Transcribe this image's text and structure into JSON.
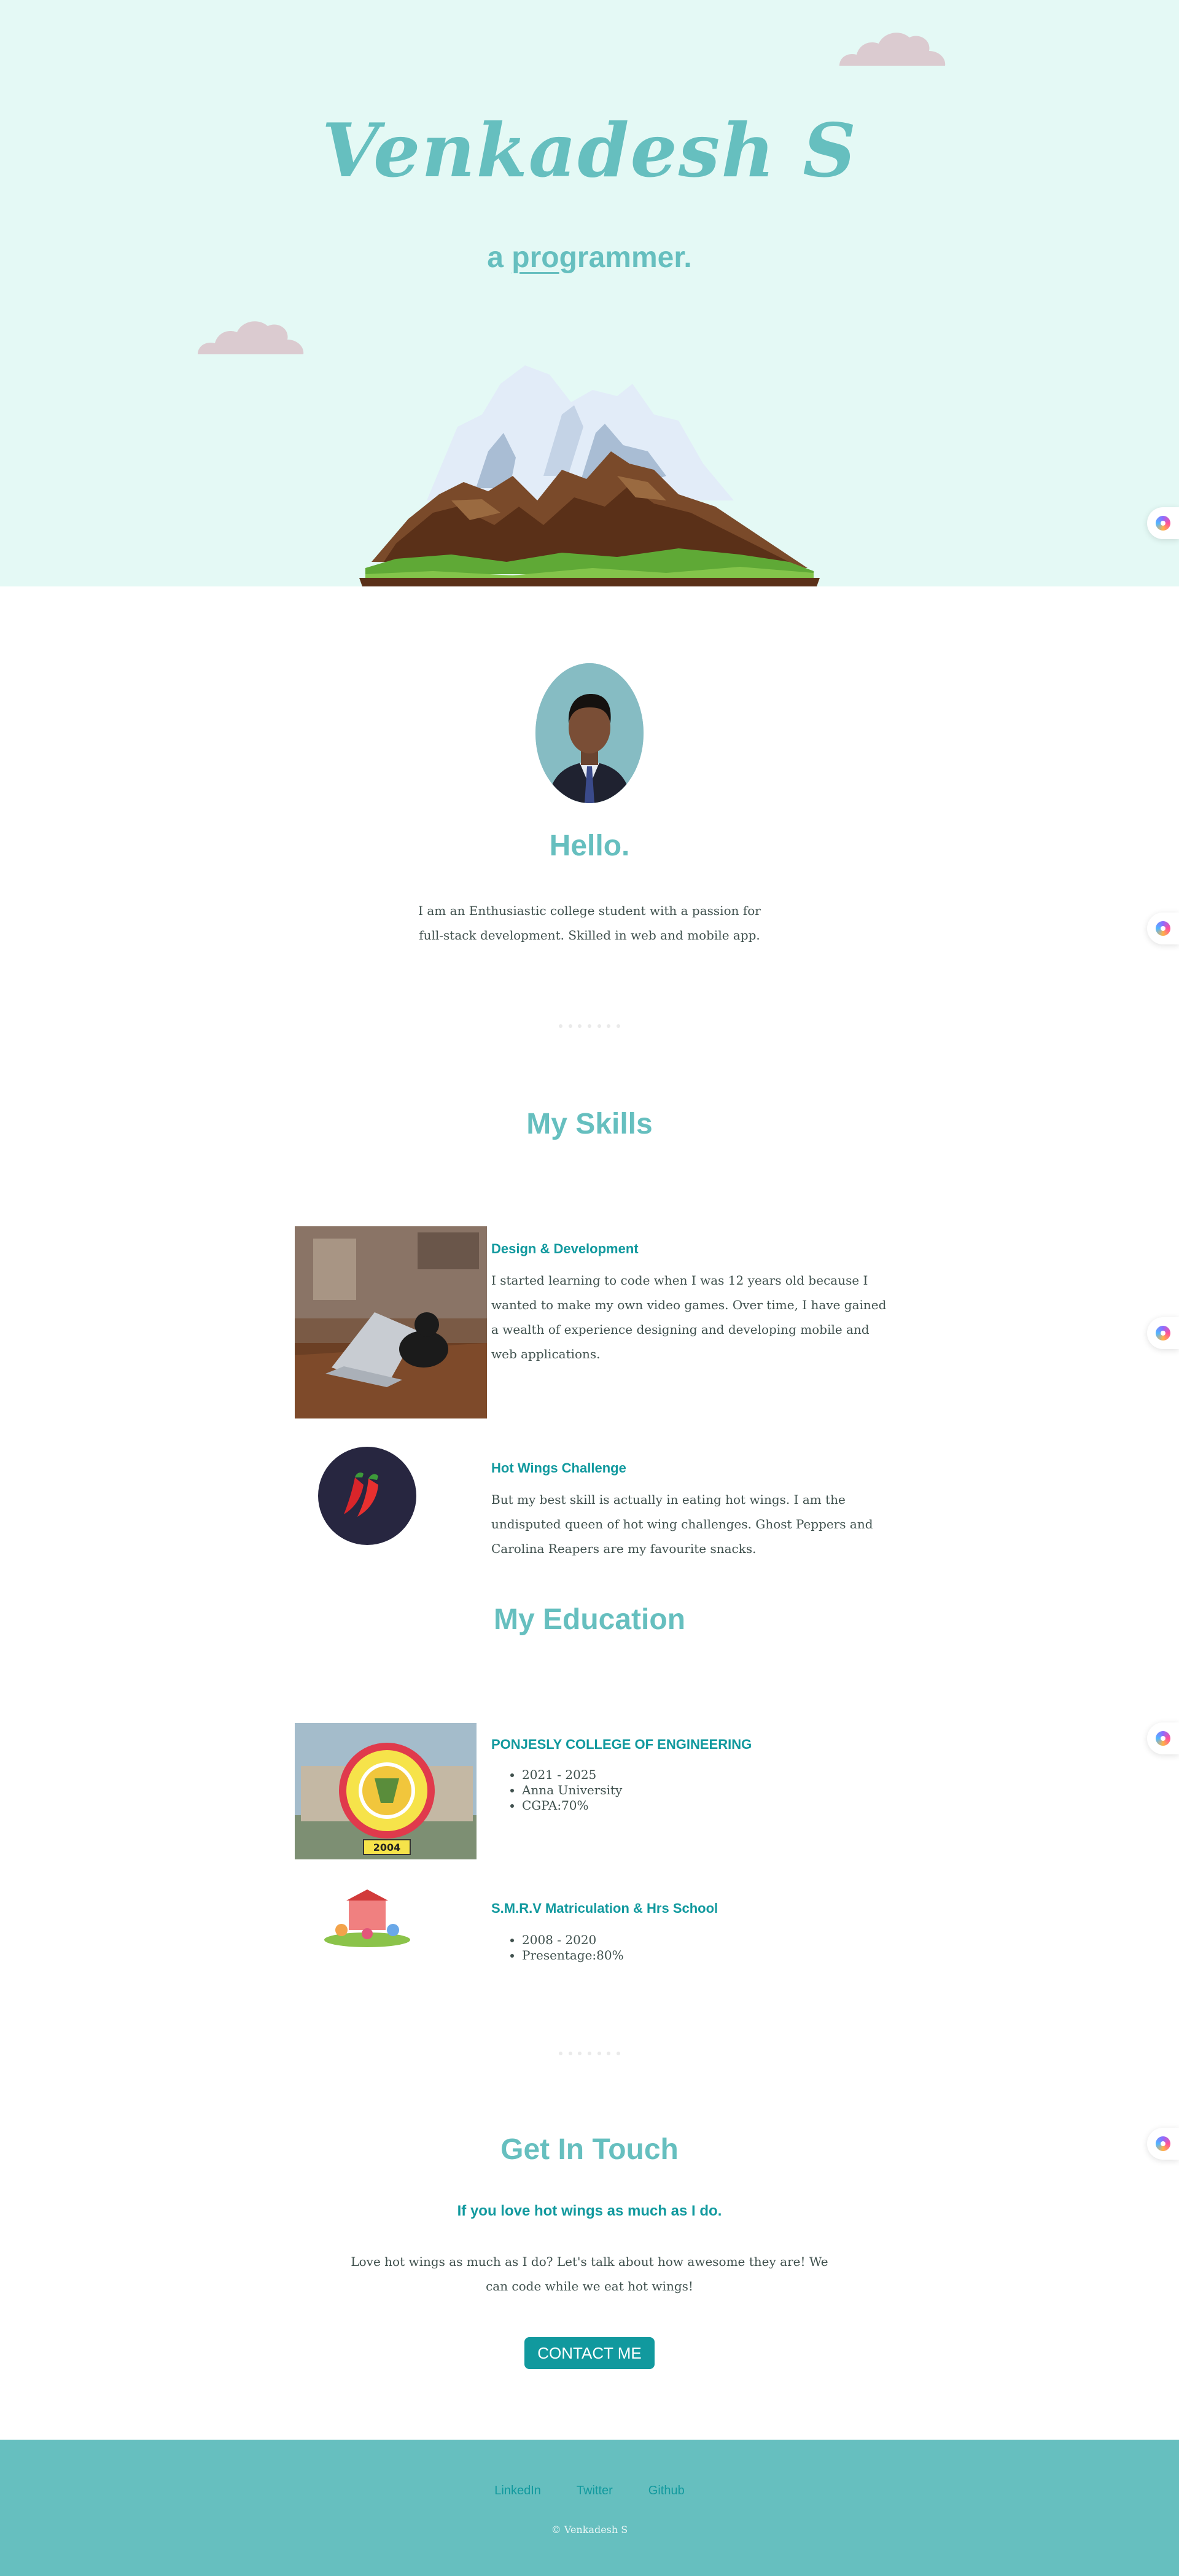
{
  "hero": {
    "title": "Venkadesh S",
    "subtitle_prefix": "a ",
    "subtitle_underlined": "pro",
    "subtitle_suffix": "grammer."
  },
  "about": {
    "heading": "Hello.",
    "text": "I am an Enthusiastic college student with a passion for full-stack development. Skilled in web and mobile app."
  },
  "skills": {
    "heading": "My Skills",
    "items": [
      {
        "title": "Design & Development",
        "text": "I started learning to code when I was 12 years old because I wanted to make my own video games. Over time, I have gained a wealth of experience designing and developing mobile and web applications."
      },
      {
        "title": "Hot Wings Challenge",
        "text": "But my best skill is actually in eating hot wings. I am the undisputed queen of hot wing challenges. Ghost Peppers and Carolina Reapers are my favourite snacks."
      }
    ]
  },
  "education": {
    "heading": "My Education",
    "items": [
      {
        "title": "PONJESLY COLLEGE OF ENGINEERING",
        "details": [
          "2021 - 2025",
          "Anna University",
          "CGPA:70%"
        ]
      },
      {
        "title": "S.M.R.V Matriculation & Hrs School",
        "details": [
          "2008 - 2020",
          "Presentage:80%"
        ]
      }
    ]
  },
  "contact": {
    "heading": "Get In Touch",
    "subheading": "If you love hot wings as much as I do.",
    "text": "Love hot wings as much as I do? Let's talk about how awesome they are! We can code while we eat hot wings!",
    "button_label": "CONTACT ME"
  },
  "footer": {
    "links": [
      "LinkedIn",
      "Twitter",
      "Github"
    ],
    "copyright": "© Venkadesh S"
  },
  "colors": {
    "hero_background": "#e4f9f5",
    "primary": "#66bfbf",
    "accent": "#11999e",
    "text": "#40514e",
    "cloud": "#dbcbd0"
  },
  "icons": [
    "cloud-icon",
    "mountain-illustration",
    "chili-icon",
    "floating-assistant-icon"
  ]
}
